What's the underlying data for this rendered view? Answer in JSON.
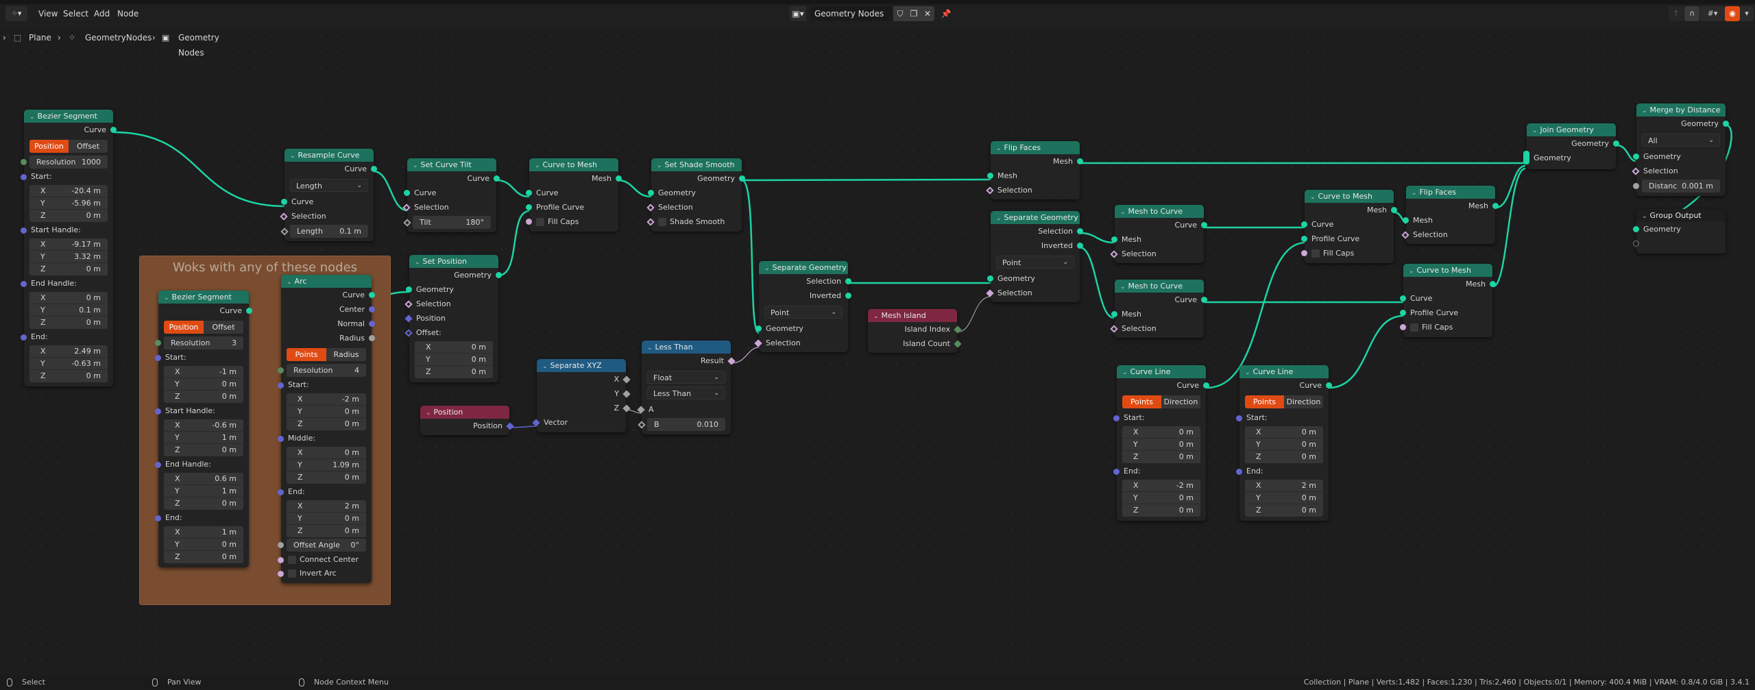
{
  "header": {
    "editor_icon": "node-editor-icon",
    "menus": [
      "View",
      "Select",
      "Add",
      "Node"
    ],
    "node_tree_name": "Geometry Nodes",
    "right_icons": [
      "parent-icon",
      "snap-icon",
      "overlay-icon",
      "blender-logo-icon"
    ]
  },
  "breadcrumb": [
    "Plane",
    "GeometryNodes",
    "Geometry Nodes"
  ],
  "frame": {
    "title": "Woks with any of these nodes"
  },
  "nodes": {
    "bezier1": {
      "title": "Bezier Segment",
      "out": "Curve",
      "modes": [
        "Position",
        "Offset"
      ],
      "resolution_label": "Resolution",
      "resolution": "1000",
      "start_label": "Start:",
      "start": [
        "-20.4 m",
        "-5.96 m",
        "0 m"
      ],
      "start_handle_label": "Start Handle:",
      "start_handle": [
        "-9.17 m",
        "3.32 m",
        "0 m"
      ],
      "end_handle_label": "End Handle:",
      "end_handle": [
        "0 m",
        "0.1 m",
        "0 m"
      ],
      "end_label": "End:",
      "end": [
        "2.49 m",
        "-0.63 m",
        "0 m"
      ]
    },
    "bezier2": {
      "title": "Bezier Segment",
      "out": "Curve",
      "modes": [
        "Position",
        "Offset"
      ],
      "resolution_label": "Resolution",
      "resolution": "3",
      "start_label": "Start:",
      "start": [
        "-1 m",
        "0 m",
        "0 m"
      ],
      "start_handle_label": "Start Handle:",
      "start_handle": [
        "-0.6 m",
        "1 m",
        "0 m"
      ],
      "end_handle_label": "End Handle:",
      "end_handle": [
        "0.6 m",
        "1 m",
        "0 m"
      ],
      "end_label": "End:",
      "end": [
        "1 m",
        "0 m",
        "0 m"
      ]
    },
    "arc": {
      "title": "Arc",
      "outs": [
        "Curve",
        "Center",
        "Normal",
        "Radius"
      ],
      "modes": [
        "Points",
        "Radius"
      ],
      "resolution_label": "Resolution",
      "resolution": "4",
      "start_label": "Start:",
      "start": [
        "-2 m",
        "0 m",
        "0 m"
      ],
      "middle_label": "Middle:",
      "middle": [
        "0 m",
        "1.09 m",
        "0 m"
      ],
      "end_label": "End:",
      "end": [
        "2 m",
        "0 m",
        "0 m"
      ],
      "offset_angle_label": "Offset Angle",
      "offset_angle": "0°",
      "connect_center": "Connect Center",
      "invert_arc": "Invert Arc"
    },
    "resample": {
      "title": "Resample Curve",
      "out": "Curve",
      "mode": "Length",
      "in_curve": "Curve",
      "in_selection": "Selection",
      "length_label": "Length",
      "length": "0.1 m"
    },
    "tilt": {
      "title": "Set Curve Tilt",
      "out": "Curve",
      "in_curve": "Curve",
      "in_selection": "Selection",
      "tilt_label": "Tilt",
      "tilt": "180°"
    },
    "setpos": {
      "title": "Set Position",
      "out": "Geometry",
      "in_geometry": "Geometry",
      "in_selection": "Selection",
      "in_position": "Position",
      "offset_label": "Offset:",
      "offset": [
        "0 m",
        "0 m",
        "0 m"
      ]
    },
    "ctm1": {
      "title": "Curve to Mesh",
      "out": "Mesh",
      "in_curve": "Curve",
      "in_profile": "Profile Curve",
      "fill_caps": "Fill Caps"
    },
    "shade": {
      "title": "Set Shade Smooth",
      "out": "Geometry",
      "in_geometry": "Geometry",
      "in_selection": "Selection",
      "shade_smooth": "Shade Smooth"
    },
    "position": {
      "title": "Position",
      "out": "Position"
    },
    "sepxyz": {
      "title": "Separate XYZ",
      "outs": [
        "X",
        "Y",
        "Z"
      ],
      "in_vector": "Vector"
    },
    "less": {
      "title": "Less Than",
      "out": "Result",
      "type": "Float",
      "op": "Less Than",
      "a_label": "A",
      "b_label": "B",
      "b": "0.010"
    },
    "sepgeo1": {
      "title": "Separate Geometry",
      "out_sel": "Selection",
      "out_inv": "Inverted",
      "domain": "Point",
      "in_geometry": "Geometry",
      "in_selection": "Selection"
    },
    "island": {
      "title": "Mesh Island",
      "out_index": "Island Index",
      "out_count": "Island Count"
    },
    "flip1": {
      "title": "Flip Faces",
      "out": "Mesh",
      "in_mesh": "Mesh",
      "in_selection": "Selection"
    },
    "sepgeo2": {
      "title": "Separate Geometry",
      "out_sel": "Selection",
      "out_inv": "Inverted",
      "domain": "Point",
      "in_geometry": "Geometry",
      "in_selection": "Selection"
    },
    "mtc1": {
      "title": "Mesh to Curve",
      "out": "Curve",
      "in_mesh": "Mesh",
      "in_selection": "Selection"
    },
    "mtc2": {
      "title": "Mesh to Curve",
      "out": "Curve",
      "in_mesh": "Mesh",
      "in_selection": "Selection"
    },
    "line1": {
      "title": "Curve Line",
      "out": "Curve",
      "modes": [
        "Points",
        "Direction"
      ],
      "start_label": "Start:",
      "start": [
        "0 m",
        "0 m",
        "0 m"
      ],
      "end_label": "End:",
      "end": [
        "-2 m",
        "0 m",
        "0 m"
      ]
    },
    "line2": {
      "title": "Curve Line",
      "out": "Curve",
      "modes": [
        "Points",
        "Direction"
      ],
      "start_label": "Start:",
      "start": [
        "0 m",
        "0 m",
        "0 m"
      ],
      "end_label": "End:",
      "end": [
        "2 m",
        "0 m",
        "0 m"
      ]
    },
    "ctm2": {
      "title": "Curve to Mesh",
      "out": "Mesh",
      "in_curve": "Curve",
      "in_profile": "Profile Curve",
      "fill_caps": "Fill Caps"
    },
    "flip2": {
      "title": "Flip Faces",
      "out": "Mesh",
      "in_mesh": "Mesh",
      "in_selection": "Selection"
    },
    "ctm3": {
      "title": "Curve to Mesh",
      "out": "Mesh",
      "in_curve": "Curve",
      "in_profile": "Profile Curve",
      "fill_caps": "Fill Caps"
    },
    "join": {
      "title": "Join Geometry",
      "out": "Geometry",
      "in_geometry": "Geometry"
    },
    "merge": {
      "title": "Merge by Distance",
      "out": "Geometry",
      "mode": "All",
      "in_geometry": "Geometry",
      "in_selection": "Selection",
      "distance_label": "Distanc",
      "distance": "0.001 m"
    },
    "groupout": {
      "title": "Group Output",
      "in_geometry": "Geometry"
    }
  },
  "axis_labels": [
    "X",
    "Y",
    "Z"
  ],
  "statusbar": {
    "hints": [
      "Select",
      "Pan View",
      "Node Context Menu"
    ],
    "stats": "Collection | Plane | Verts:1,482 | Faces:1,230 | Tris:2,460 | Objects:0/1 | Memory: 400.4 MiB | VRAM: 0.8/4.0 GiB | 3.4.1"
  },
  "colors": {
    "geometry_socket": "#1dd4a4",
    "vector_socket": "#6464d0",
    "accent_active": "#e04b13",
    "geometry_header": "#1d725e",
    "utility_header": "#1f5a82",
    "input_header": "#7f2741",
    "frame": "#7a4d30"
  }
}
